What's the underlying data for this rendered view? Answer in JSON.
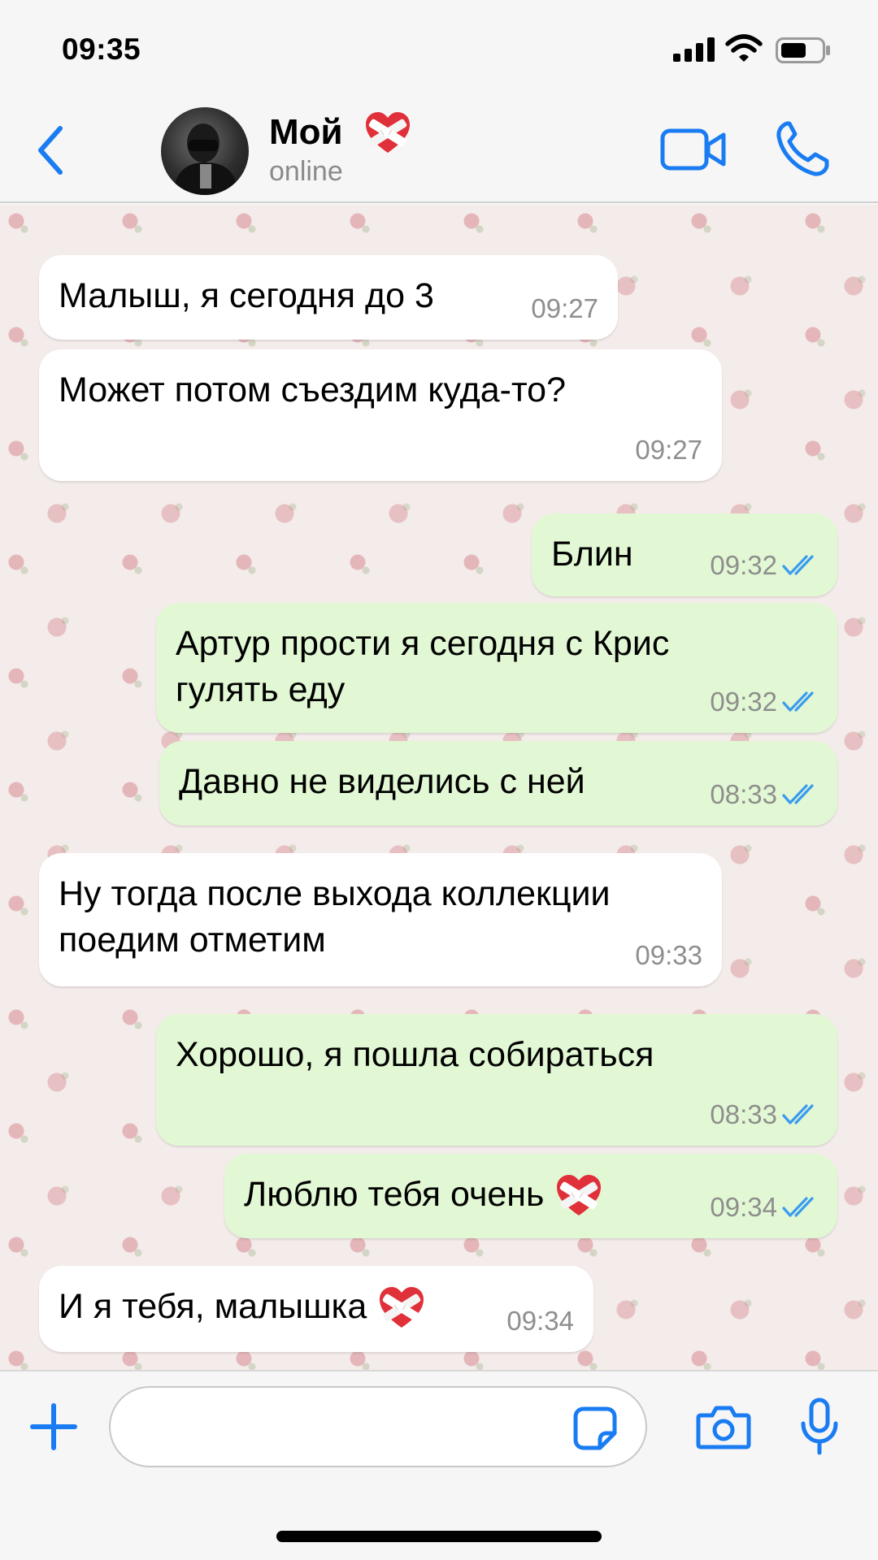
{
  "status_bar": {
    "time": "09:35"
  },
  "header": {
    "contact_name": "Мой",
    "contact_status": "online",
    "name_emoji": "mending-heart-emoji"
  },
  "messages": [
    {
      "direction": "in",
      "text": "Малыш, я сегодня до 3",
      "time": "09:27"
    },
    {
      "direction": "in",
      "text": "Может потом съездим куда-то?",
      "time": "09:27"
    },
    {
      "direction": "out",
      "text": "Блин",
      "time": "09:32",
      "status": "read"
    },
    {
      "direction": "out",
      "lines": [
        "Артур прости я сегодня с Крис",
        "гулять еду"
      ],
      "time": "09:32",
      "status": "read"
    },
    {
      "direction": "out",
      "text": "Давно не виделись с ней",
      "time": "08:33",
      "status": "read"
    },
    {
      "direction": "in",
      "lines": [
        "Ну тогда после выхода коллекции",
        "поедим отметим"
      ],
      "time": "09:33"
    },
    {
      "direction": "out",
      "text": "Хорошо, я пошла собираться",
      "time": "08:33",
      "status": "read"
    },
    {
      "direction": "out",
      "text": "Люблю тебя очень",
      "emoji": "mending-heart-emoji",
      "time": "09:34",
      "status": "read"
    },
    {
      "direction": "in",
      "text": "И я тебя, малышка",
      "emoji": "mending-heart-emoji",
      "time": "09:34"
    }
  ],
  "input": {
    "placeholder": ""
  },
  "colors": {
    "accent": "#1a7cf2",
    "incoming_bubble": "#ffffff",
    "outgoing_bubble": "#e2f8d4",
    "read_ticks": "#3a9bf0",
    "timestamp": "#8e8e8e"
  },
  "icons": {
    "back": "chevron-left-icon",
    "video": "video-camera-icon",
    "call": "phone-icon",
    "plus": "plus-icon",
    "sticker": "sticker-icon",
    "camera": "camera-icon",
    "mic": "microphone-icon"
  }
}
